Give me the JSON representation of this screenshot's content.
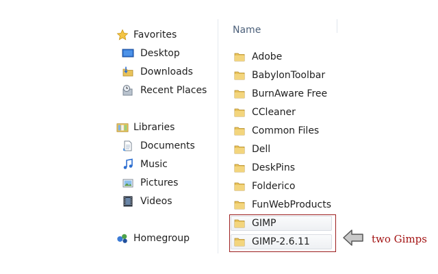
{
  "navigation": {
    "favorites": {
      "label": "Favorites",
      "items": [
        {
          "label": "Desktop"
        },
        {
          "label": "Downloads"
        },
        {
          "label": "Recent Places"
        }
      ]
    },
    "libraries": {
      "label": "Libraries",
      "items": [
        {
          "label": "Documents"
        },
        {
          "label": "Music"
        },
        {
          "label": "Pictures"
        },
        {
          "label": "Videos"
        }
      ]
    },
    "homegroup": {
      "label": "Homegroup"
    }
  },
  "files": {
    "column_header": "Name",
    "items": [
      {
        "name": "Adobe"
      },
      {
        "name": "BabylonToolbar"
      },
      {
        "name": "BurnAware Free"
      },
      {
        "name": "CCleaner"
      },
      {
        "name": "Common Files"
      },
      {
        "name": "Dell"
      },
      {
        "name": "DeskPins"
      },
      {
        "name": "Folderico"
      },
      {
        "name": "FunWebProducts"
      },
      {
        "name": "GIMP"
      },
      {
        "name": "GIMP-2.6.11"
      }
    ]
  },
  "annotation": {
    "text": "two Gimps",
    "color": "#a31313"
  },
  "colors": {
    "folder": "#e8c25a",
    "header_text": "#4c607a"
  }
}
